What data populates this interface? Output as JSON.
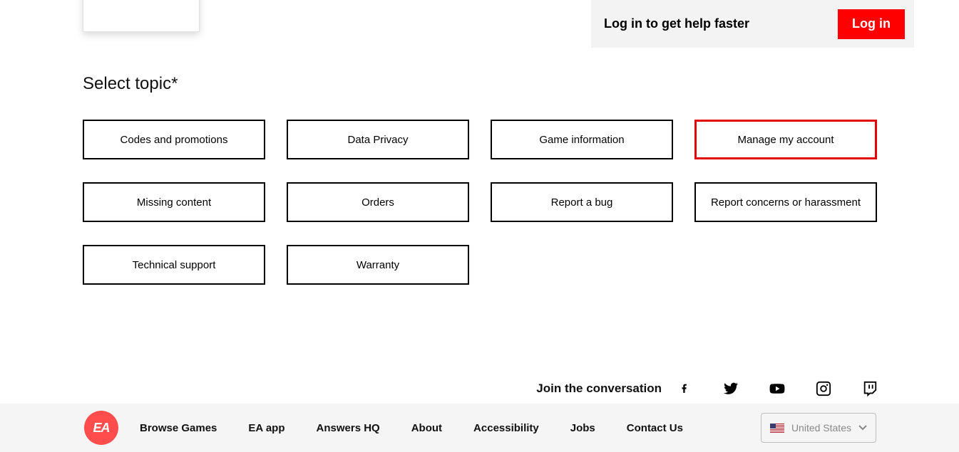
{
  "login_banner": {
    "message": "Log in to get help faster",
    "button": "Log in"
  },
  "heading": "Select topic*",
  "topics": [
    {
      "label": "Codes and promotions",
      "selected": false
    },
    {
      "label": "Data Privacy",
      "selected": false
    },
    {
      "label": "Game information",
      "selected": false
    },
    {
      "label": "Manage my account",
      "selected": true
    },
    {
      "label": "Missing content",
      "selected": false
    },
    {
      "label": "Orders",
      "selected": false
    },
    {
      "label": "Report a bug",
      "selected": false
    },
    {
      "label": "Report concerns or harassment",
      "selected": false
    },
    {
      "label": "Technical support",
      "selected": false
    },
    {
      "label": "Warranty",
      "selected": false
    }
  ],
  "social": {
    "label": "Join the conversation",
    "icons": [
      "facebook",
      "twitter",
      "youtube",
      "instagram",
      "twitch"
    ]
  },
  "footer": {
    "logo_text": "EA",
    "links": [
      "Browse Games",
      "EA app",
      "Answers HQ",
      "About",
      "Accessibility",
      "Jobs",
      "Contact Us"
    ],
    "region": "United States"
  }
}
